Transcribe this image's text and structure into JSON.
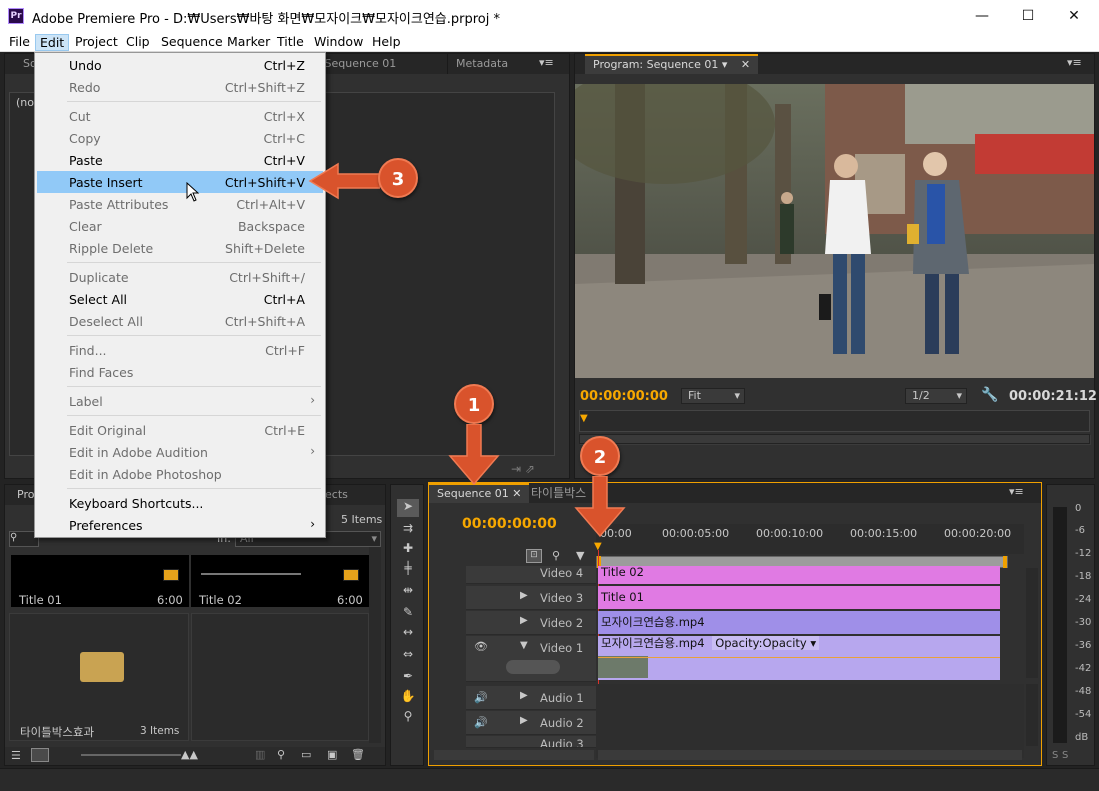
{
  "window": {
    "title": "Adobe Premiere Pro - D:₩Users₩바탕 화면₩모자이크₩모자이크연습.prproj *",
    "app_icon": "Pr"
  },
  "menubar": [
    "File",
    "Edit",
    "Project",
    "Clip",
    "Sequence",
    "Marker",
    "Title",
    "Window",
    "Help"
  ],
  "source_panel": {
    "tab_partial": "So",
    "tab_seq": "r: Sequence 01",
    "tab_metadata": "Metadata",
    "no_clip": "(no"
  },
  "program_panel": {
    "tab": "Program: Sequence 01",
    "timecode": "00:00:00:00",
    "fit": "Fit",
    "resolution": "1/2",
    "duration": "00:00:21:12"
  },
  "edit_menu": {
    "items": [
      {
        "label": "Undo",
        "shortcut": "Ctrl+Z",
        "enabled": true
      },
      {
        "label": "Redo",
        "shortcut": "Ctrl+Shift+Z",
        "enabled": false
      },
      {
        "label": "Cut",
        "shortcut": "Ctrl+X",
        "enabled": false
      },
      {
        "label": "Copy",
        "shortcut": "Ctrl+C",
        "enabled": false
      },
      {
        "label": "Paste",
        "shortcut": "Ctrl+V",
        "enabled": true
      },
      {
        "label": "Paste Insert",
        "shortcut": "Ctrl+Shift+V",
        "enabled": true,
        "highlighted": true
      },
      {
        "label": "Paste Attributes",
        "shortcut": "Ctrl+Alt+V",
        "enabled": false
      },
      {
        "label": "Clear",
        "shortcut": "Backspace",
        "enabled": false
      },
      {
        "label": "Ripple Delete",
        "shortcut": "Shift+Delete",
        "enabled": false
      },
      {
        "label": "Duplicate",
        "shortcut": "Ctrl+Shift+/",
        "enabled": false
      },
      {
        "label": "Select All",
        "shortcut": "Ctrl+A",
        "enabled": true
      },
      {
        "label": "Deselect All",
        "shortcut": "Ctrl+Shift+A",
        "enabled": false
      },
      {
        "label": "Find...",
        "shortcut": "Ctrl+F",
        "enabled": false
      },
      {
        "label": "Find Faces",
        "shortcut": "",
        "enabled": false
      },
      {
        "label": "Label",
        "shortcut": "",
        "enabled": false,
        "submenu": true
      },
      {
        "label": "Edit Original",
        "shortcut": "Ctrl+E",
        "enabled": false
      },
      {
        "label": "Edit in Adobe Audition",
        "shortcut": "",
        "enabled": false,
        "submenu": true
      },
      {
        "label": "Edit in Adobe Photoshop",
        "shortcut": "",
        "enabled": false
      },
      {
        "label": "Keyboard Shortcuts...",
        "shortcut": "",
        "enabled": true
      },
      {
        "label": "Preferences",
        "shortcut": "",
        "enabled": true,
        "submenu": true
      }
    ]
  },
  "project_panel": {
    "tab_partial": "Proj",
    "tab_effects": "ects",
    "items_count": "5 Items",
    "in_label": "In:",
    "in_value": "All",
    "bins": [
      {
        "name": "Title 01",
        "duration": "6:00"
      },
      {
        "name": "Title 02",
        "duration": "6:00"
      },
      {
        "name": "타이틀박스효과",
        "duration": "3 Items"
      }
    ]
  },
  "timeline": {
    "tabs": [
      "Sequence 01",
      "타이틀박스"
    ],
    "timecode": "00:00:00:00",
    "ruler": [
      "00:00",
      "00:00:05:00",
      "00:00:10:00",
      "00:00:15:00",
      "00:00:20:00"
    ],
    "tracks": [
      {
        "name": "Video 4",
        "clip": "Title 02"
      },
      {
        "name": "Video 3",
        "clip": "Title 01"
      },
      {
        "name": "Video 2",
        "clip": "모자이크연습용.mp4"
      },
      {
        "name": "Video 1",
        "clip": "모자이크연습용.mp4",
        "fx": "Opacity:Opacity"
      },
      {
        "name": "Audio 1",
        "clip": ""
      },
      {
        "name": "Audio 2",
        "clip": ""
      },
      {
        "name": "Audio 3",
        "clip": ""
      }
    ]
  },
  "vu_meter": [
    "0",
    "-6",
    "-12",
    "-18",
    "-24",
    "-30",
    "-36",
    "-42",
    "-48",
    "-54",
    "dB"
  ],
  "vu_bottom": [
    "S",
    "S"
  ],
  "callouts": [
    "1",
    "2",
    "3"
  ],
  "colors": {
    "accent": "#f7a800",
    "callout": "#d9532c",
    "video_title_clip": "#e07ae3",
    "video_clip": "#9f8fe8",
    "highlight": "#91c9f7"
  }
}
